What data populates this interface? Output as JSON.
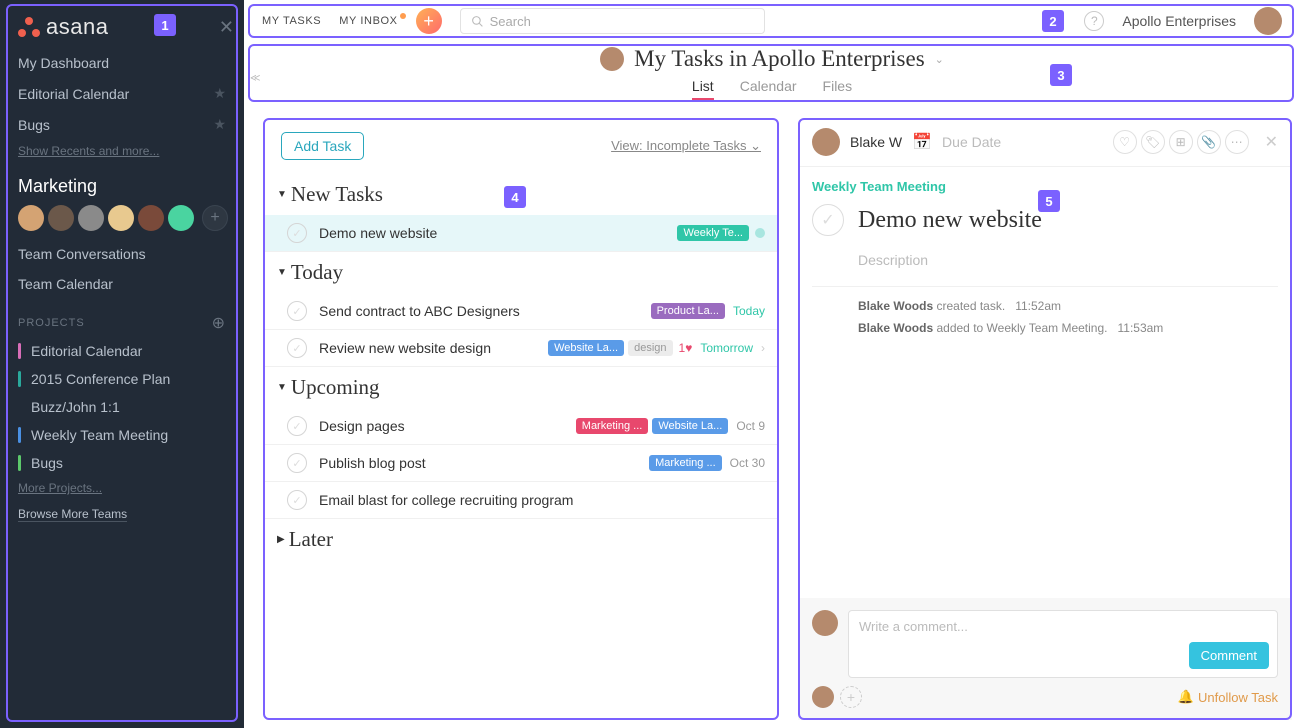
{
  "sidebar": {
    "logo_text": "asana",
    "my_dashboard": "My Dashboard",
    "recents": [
      {
        "label": "Editorial Calendar",
        "starred": true
      },
      {
        "label": "Bugs",
        "starred": true
      }
    ],
    "show_recents": "Show Recents and more...",
    "team_heading": "Marketing",
    "team_conversations": "Team Conversations",
    "team_calendar": "Team Calendar",
    "projects_label": "PROJECTS",
    "projects": [
      {
        "label": "Editorial Calendar",
        "color": "c-pink"
      },
      {
        "label": "2015 Conference Plan",
        "color": "c-teal"
      },
      {
        "label": "Buzz/John 1:1",
        "color": ""
      },
      {
        "label": "Weekly Team Meeting",
        "color": "c-blue"
      },
      {
        "label": "Bugs",
        "color": "c-green"
      }
    ],
    "more_projects": "More Projects...",
    "browse_teams": "Browse More Teams"
  },
  "topbar": {
    "my_tasks": "MY TASKS",
    "my_inbox": "MY INBOX",
    "search_placeholder": "Search",
    "org": "Apollo Enterprises"
  },
  "header": {
    "title": "My Tasks in Apollo Enterprises",
    "tabs": {
      "list": "List",
      "calendar": "Calendar",
      "files": "Files"
    }
  },
  "list": {
    "add_task": "Add Task",
    "view_label": "View: Incomplete Tasks",
    "sections": {
      "new": "New Tasks",
      "today": "Today",
      "upcoming": "Upcoming",
      "later": "Later"
    },
    "tasks": {
      "new0": {
        "name": "Demo new website",
        "tag": "Weekly Te..."
      },
      "today0": {
        "name": "Send contract to ABC Designers",
        "tag": "Product La...",
        "due": "Today"
      },
      "today1": {
        "name": "Review new website design",
        "tag1": "Website La...",
        "tag2": "design",
        "hearts": "1",
        "due": "Tomorrow"
      },
      "up0": {
        "name": "Design pages",
        "tag1": "Marketing ...",
        "tag2": "Website La...",
        "due": "Oct 9"
      },
      "up1": {
        "name": "Publish blog post",
        "tag": "Marketing ...",
        "due": "Oct 30"
      },
      "up2": {
        "name": "Email blast for college recruiting program"
      }
    }
  },
  "detail": {
    "assignee": "Blake W",
    "due_placeholder": "Due Date",
    "project_chip": "Weekly Team Meeting",
    "title": "Demo new website",
    "description_placeholder": "Description",
    "activity": [
      {
        "who": "Blake Woods",
        "what": "created task.",
        "time": "11:52am"
      },
      {
        "who": "Blake Woods",
        "what": "added to Weekly Team Meeting.",
        "time": "11:53am"
      }
    ],
    "comment_placeholder": "Write a comment...",
    "comment_btn": "Comment",
    "unfollow": "Unfollow Task"
  },
  "callouts": {
    "c1": "1",
    "c2": "2",
    "c3": "3",
    "c4": "4",
    "c5": "5"
  }
}
